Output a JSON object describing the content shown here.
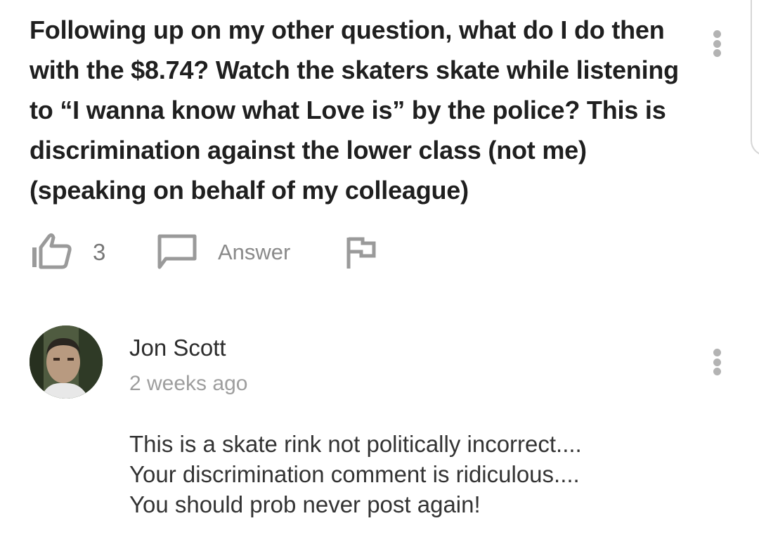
{
  "question": {
    "text": "Following up on my other question, what do I do then with the $8.74? Watch the skaters skate while listening to “I wanna know what Love is” by the police? This is discrimination against the lower class (not me) (speaking on behalf of my colleague)",
    "likes": "3",
    "answer_label": "Answer"
  },
  "comment": {
    "author": "Jon Scott",
    "time": "2 weeks ago",
    "lines": [
      "This is a skate rink not politically incorrect....",
      "Your discrimination comment is ridiculous....",
      "You should prob never post again!"
    ]
  },
  "icons": {
    "more": "more-vert-icon",
    "like": "thumbs-up-icon",
    "answer": "comment-bubble-icon",
    "flag": "flag-icon"
  },
  "colors": {
    "icon_gray": "#9a9a9a",
    "meta_gray": "#9e9e9e"
  }
}
